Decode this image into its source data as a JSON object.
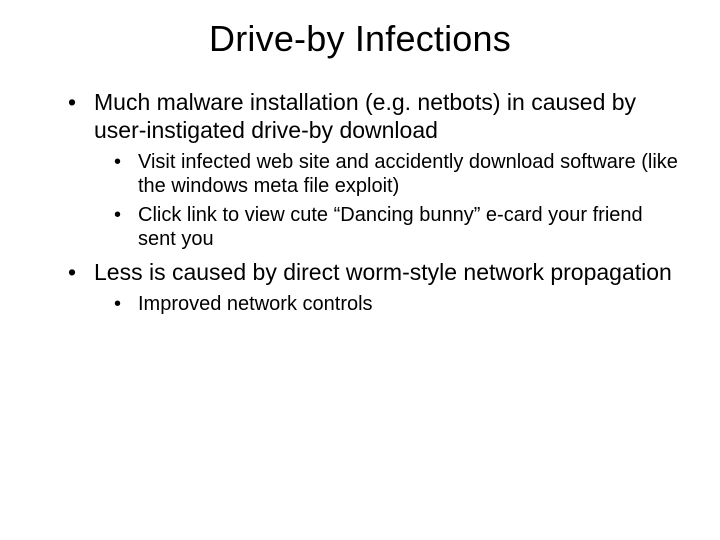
{
  "title": "Drive-by Infections",
  "bullets": [
    {
      "text": "Much malware installation (e.g. netbots) in caused by user-instigated drive-by download",
      "sub": [
        "Visit infected web site and accidently download software (like the windows meta file exploit)",
        "Click link to view cute “Dancing bunny” e-card your friend sent you"
      ]
    },
    {
      "text": "Less is caused by direct worm-style network propagation",
      "sub": [
        "Improved network controls"
      ]
    }
  ]
}
